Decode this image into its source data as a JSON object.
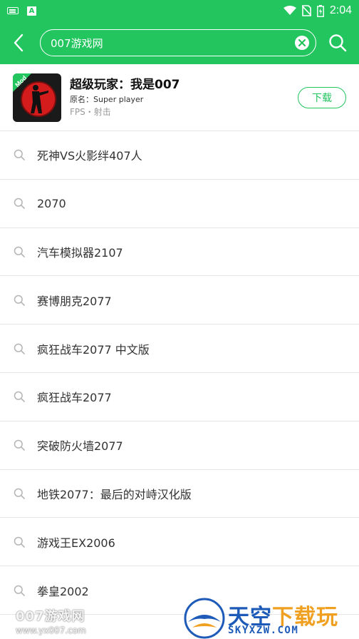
{
  "status_bar": {
    "time": "2:04"
  },
  "search": {
    "query": "007游戏网"
  },
  "game": {
    "title": "超级玩家：我是007",
    "original_name": "原名：Super player",
    "tags": "FPS・射击",
    "badge": "Mod",
    "download_label": "下载"
  },
  "suggestions": [
    "死神VS火影绊407人",
    "2070",
    "汽车模拟器2107",
    "赛博朋克2077",
    "疯狂战车2077 中文版",
    "疯狂战车2077",
    "突破防火墙2077",
    "地铁2077：最后的对峙汉化版",
    "游戏王EX2006",
    "拳皇2002"
  ],
  "watermark": {
    "left_text": "007游戏网",
    "left_url": "www.yx007.com",
    "right_title_a": "天空",
    "right_title_b": "下载玩",
    "right_url": "SKYXZW.COM"
  },
  "colors": {
    "brand_green": "#22c55e",
    "divider": "#e6e6e6"
  }
}
